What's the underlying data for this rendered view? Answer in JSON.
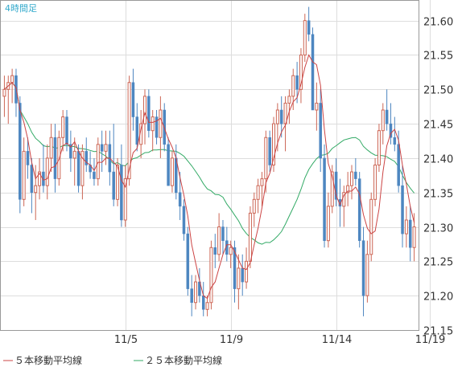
{
  "chart_data": {
    "type": "candlestick",
    "title": "4時間足",
    "y_ticks": [
      "21.60",
      "21.55",
      "21.50",
      "21.45",
      "21.40",
      "21.35",
      "21.30",
      "21.25",
      "21.20",
      "21.15"
    ],
    "ylim": [
      21.15,
      21.63
    ],
    "x_tick_labels": [
      {
        "label": "11/5",
        "index": 31
      },
      {
        "label": "11/9",
        "index": 58
      },
      {
        "label": "11/14",
        "index": 85
      },
      {
        "label": "11/19",
        "index": 109
      }
    ],
    "grid": true,
    "colors": {
      "up": "#cc6655",
      "down": "#4d86c0",
      "ma5": "#cc4444",
      "ma25": "#33aa66",
      "grid": "#dddddd",
      "frame": "#999999",
      "title": "#33aacc"
    },
    "legend": [
      {
        "name": "５本移動平均線",
        "color": "#cc4444"
      },
      {
        "name": "２５本移動平均線",
        "color": "#33aa66"
      }
    ],
    "candles": [
      [
        21.49,
        21.52,
        21.46,
        21.5
      ],
      [
        21.5,
        21.52,
        21.45,
        21.51
      ],
      [
        21.51,
        21.53,
        21.48,
        21.52
      ],
      [
        21.52,
        21.53,
        21.46,
        21.48
      ],
      [
        21.48,
        21.49,
        21.32,
        21.34
      ],
      [
        21.34,
        21.43,
        21.33,
        21.41
      ],
      [
        21.41,
        21.43,
        21.37,
        21.39
      ],
      [
        21.39,
        21.4,
        21.32,
        21.35
      ],
      [
        21.35,
        21.39,
        21.31,
        21.36
      ],
      [
        21.36,
        21.4,
        21.34,
        21.38
      ],
      [
        21.38,
        21.42,
        21.35,
        21.36
      ],
      [
        21.36,
        21.42,
        21.34,
        21.4
      ],
      [
        21.4,
        21.45,
        21.38,
        21.43
      ],
      [
        21.43,
        21.45,
        21.35,
        21.37
      ],
      [
        21.37,
        21.44,
        21.36,
        21.43
      ],
      [
        21.43,
        21.47,
        21.41,
        21.46
      ],
      [
        21.46,
        21.47,
        21.41,
        21.42
      ],
      [
        21.42,
        21.44,
        21.38,
        21.4
      ],
      [
        21.4,
        21.43,
        21.36,
        21.41
      ],
      [
        21.41,
        21.42,
        21.35,
        21.36
      ],
      [
        21.36,
        21.42,
        21.34,
        21.41
      ],
      [
        21.41,
        21.43,
        21.38,
        21.39
      ],
      [
        21.39,
        21.41,
        21.37,
        21.38
      ],
      [
        21.38,
        21.4,
        21.36,
        21.37
      ],
      [
        21.37,
        21.43,
        21.36,
        21.42
      ],
      [
        21.42,
        21.44,
        21.38,
        21.41
      ],
      [
        21.41,
        21.44,
        21.39,
        21.42
      ],
      [
        21.42,
        21.44,
        21.36,
        21.38
      ],
      [
        21.38,
        21.45,
        21.33,
        21.34
      ],
      [
        21.34,
        21.4,
        21.33,
        21.39
      ],
      [
        21.39,
        21.42,
        21.3,
        21.31
      ],
      [
        21.31,
        21.39,
        21.3,
        21.37
      ],
      [
        21.37,
        21.52,
        21.36,
        21.51
      ],
      [
        21.51,
        21.53,
        21.44,
        21.46
      ],
      [
        21.46,
        21.48,
        21.41,
        21.42
      ],
      [
        21.42,
        21.47,
        21.4,
        21.45
      ],
      [
        21.45,
        21.5,
        21.42,
        21.49
      ],
      [
        21.49,
        21.5,
        21.43,
        21.44
      ],
      [
        21.44,
        21.47,
        21.41,
        21.46
      ],
      [
        21.46,
        21.47,
        21.42,
        21.43
      ],
      [
        21.43,
        21.49,
        21.4,
        21.47
      ],
      [
        21.47,
        21.48,
        21.41,
        21.42
      ],
      [
        21.42,
        21.43,
        21.36,
        21.36
      ],
      [
        21.36,
        21.41,
        21.35,
        21.4
      ],
      [
        21.4,
        21.42,
        21.34,
        21.35
      ],
      [
        21.35,
        21.38,
        21.31,
        21.33
      ],
      [
        21.33,
        21.34,
        21.28,
        21.29
      ],
      [
        21.29,
        21.3,
        21.2,
        21.21
      ],
      [
        21.21,
        21.23,
        21.17,
        21.19
      ],
      [
        21.19,
        21.23,
        21.18,
        21.22
      ],
      [
        21.22,
        21.24,
        21.19,
        21.2
      ],
      [
        21.2,
        21.22,
        21.17,
        21.18
      ],
      [
        21.18,
        21.2,
        21.17,
        21.19
      ],
      [
        21.19,
        21.28,
        21.18,
        21.27
      ],
      [
        21.27,
        21.29,
        21.24,
        21.26
      ],
      [
        21.26,
        21.32,
        21.25,
        21.3
      ],
      [
        21.3,
        21.31,
        21.26,
        21.28
      ],
      [
        21.28,
        21.3,
        21.25,
        21.26
      ],
      [
        21.26,
        21.28,
        21.24,
        21.27
      ],
      [
        21.27,
        21.28,
        21.19,
        21.21
      ],
      [
        21.21,
        21.26,
        21.18,
        21.24
      ],
      [
        21.24,
        21.26,
        21.2,
        21.22
      ],
      [
        21.22,
        21.27,
        21.21,
        21.25
      ],
      [
        21.25,
        21.33,
        21.24,
        21.32
      ],
      [
        21.32,
        21.35,
        21.3,
        21.34
      ],
      [
        21.34,
        21.37,
        21.32,
        21.36
      ],
      [
        21.36,
        21.38,
        21.33,
        21.37
      ],
      [
        21.37,
        21.44,
        21.35,
        21.43
      ],
      [
        21.43,
        21.44,
        21.38,
        21.39
      ],
      [
        21.39,
        21.46,
        21.38,
        21.45
      ],
      [
        21.45,
        21.48,
        21.41,
        21.47
      ],
      [
        21.47,
        21.49,
        21.43,
        21.45
      ],
      [
        21.45,
        21.49,
        21.41,
        21.48
      ],
      [
        21.48,
        21.5,
        21.45,
        21.49
      ],
      [
        21.49,
        21.53,
        21.47,
        21.52
      ],
      [
        21.52,
        21.54,
        21.48,
        21.5
      ],
      [
        21.5,
        21.56,
        21.48,
        21.55
      ],
      [
        21.55,
        21.61,
        21.54,
        21.6
      ],
      [
        21.6,
        21.62,
        21.57,
        21.58
      ],
      [
        21.58,
        21.59,
        21.49,
        21.47
      ],
      [
        21.47,
        21.51,
        21.44,
        21.48
      ],
      [
        21.48,
        21.5,
        21.38,
        21.4
      ],
      [
        21.4,
        21.42,
        21.27,
        21.28
      ],
      [
        21.28,
        21.35,
        21.27,
        21.33
      ],
      [
        21.33,
        21.39,
        21.32,
        21.38
      ],
      [
        21.38,
        21.4,
        21.33,
        21.34
      ],
      [
        21.34,
        21.37,
        21.3,
        21.33
      ],
      [
        21.33,
        21.36,
        21.3,
        21.35
      ],
      [
        21.35,
        21.38,
        21.33,
        21.36
      ],
      [
        21.36,
        21.39,
        21.34,
        21.38
      ],
      [
        21.38,
        21.4,
        21.36,
        21.37
      ],
      [
        21.37,
        21.38,
        21.27,
        21.28
      ],
      [
        21.28,
        21.3,
        21.17,
        21.2
      ],
      [
        21.2,
        21.28,
        21.19,
        21.26
      ],
      [
        21.26,
        21.35,
        21.25,
        21.34
      ],
      [
        21.34,
        21.4,
        21.33,
        21.39
      ],
      [
        21.39,
        21.45,
        21.38,
        21.44
      ],
      [
        21.44,
        21.48,
        21.42,
        21.47
      ],
      [
        21.47,
        21.5,
        21.44,
        21.45
      ],
      [
        21.45,
        21.48,
        21.42,
        21.43
      ],
      [
        21.43,
        21.46,
        21.41,
        21.42
      ],
      [
        21.42,
        21.44,
        21.35,
        21.36
      ],
      [
        21.36,
        21.39,
        21.27,
        21.29
      ],
      [
        21.29,
        21.33,
        21.27,
        21.31
      ],
      [
        21.31,
        21.33,
        21.25,
        21.27
      ],
      [
        21.27,
        21.32,
        21.25,
        21.3
      ]
    ]
  }
}
